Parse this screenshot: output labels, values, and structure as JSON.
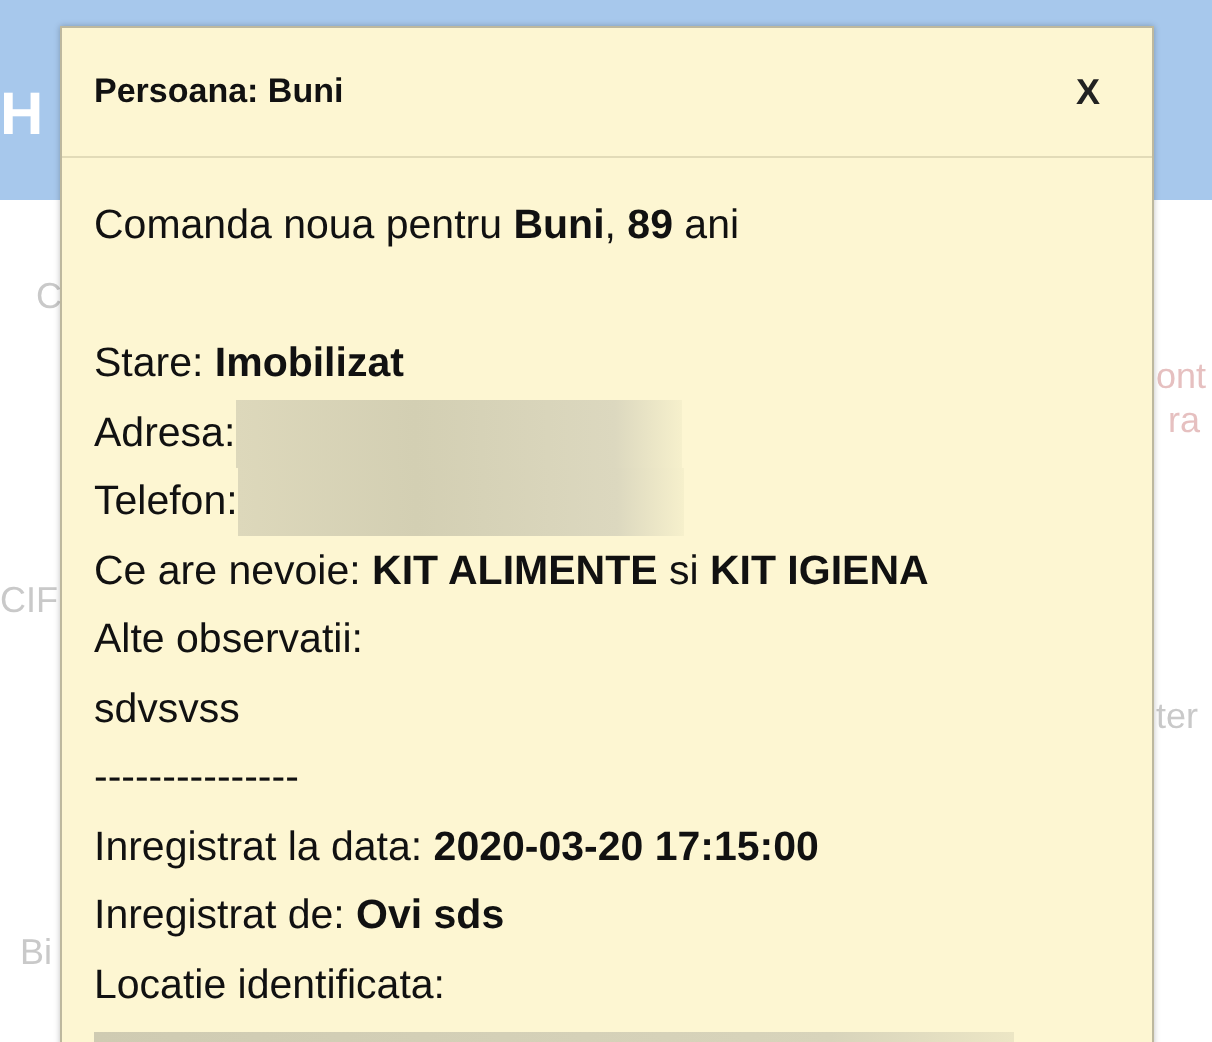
{
  "background": {
    "fragments": [
      {
        "text": "H"
      },
      {
        "text": "C"
      },
      {
        "text": "CIF"
      },
      {
        "text": "Bi"
      },
      {
        "text": "ont"
      },
      {
        "text": "ra"
      },
      {
        "text": "ter"
      }
    ]
  },
  "dialog": {
    "title": "Persoana: Buni",
    "close": "X",
    "lines": [
      {
        "kind": "text",
        "text": "Comanda noua pentru **Buni**, **89** ani"
      },
      {
        "kind": "blank"
      },
      {
        "kind": "text",
        "text": "Stare: **Imobilizat**"
      },
      {
        "kind": "redacted",
        "text": "Adresa:"
      },
      {
        "kind": "redacted",
        "text": "Telefon:"
      },
      {
        "kind": "text",
        "text": "Ce are nevoie: **KIT ALIMENTE** si **KIT IGIENA**"
      },
      {
        "kind": "text",
        "text": "Alte observatii:"
      },
      {
        "kind": "text",
        "text": "sdvsvss"
      },
      {
        "kind": "text",
        "text": "---------------"
      },
      {
        "kind": "text",
        "text": "Inregistrat la data: **2020-03-20 17:15:00**"
      },
      {
        "kind": "text",
        "text": "Inregistrat de: **Ovi sds**"
      },
      {
        "kind": "text",
        "text": "Locatie identificata:"
      },
      {
        "kind": "redacted-bar"
      }
    ]
  }
}
